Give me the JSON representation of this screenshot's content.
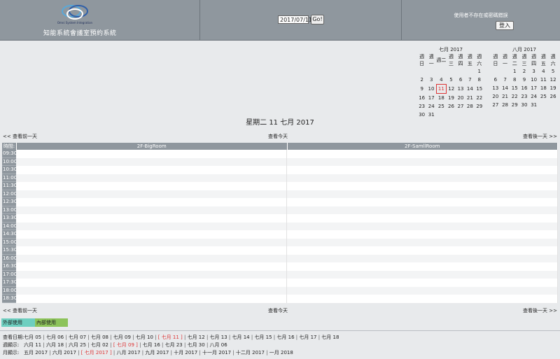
{
  "header": {
    "logo_text": "Omni System Integration",
    "app_title": "知能系統會議室預約系統",
    "date_value": "2017/07/11",
    "go_label": "Go!",
    "user_message": "使用者不存在或密碼錯誤",
    "login_label": "登入"
  },
  "calendars": [
    {
      "title": "七月 2017",
      "weekdays": [
        "週日",
        "週一",
        "週二",
        "週三",
        "週四",
        "週五",
        "週六"
      ],
      "weeks": [
        [
          "",
          "",
          "",
          "",
          "",
          "",
          "1"
        ],
        [
          "2",
          "3",
          "4",
          "5",
          "6",
          "7",
          "8"
        ],
        [
          "9",
          "10",
          "11",
          "12",
          "13",
          "14",
          "15"
        ],
        [
          "16",
          "17",
          "18",
          "19",
          "20",
          "21",
          "22"
        ],
        [
          "23",
          "24",
          "25",
          "26",
          "27",
          "28",
          "29"
        ],
        [
          "30",
          "31",
          "",
          "",
          "",
          "",
          ""
        ]
      ],
      "today": "11"
    },
    {
      "title": "八月 2017",
      "weekdays": [
        "週日",
        "週一",
        "週二",
        "週三",
        "週四",
        "週五",
        "週六"
      ],
      "weeks": [
        [
          "",
          "",
          "1",
          "2",
          "3",
          "4",
          "5"
        ],
        [
          "6",
          "7",
          "8",
          "9",
          "10",
          "11",
          "12"
        ],
        [
          "13",
          "14",
          "15",
          "16",
          "17",
          "18",
          "19"
        ],
        [
          "20",
          "21",
          "22",
          "23",
          "24",
          "25",
          "26"
        ],
        [
          "27",
          "28",
          "29",
          "30",
          "31",
          "",
          ""
        ]
      ],
      "today": ""
    }
  ],
  "day_title": "星期二 11 七月 2017",
  "nav": {
    "prev": "<< 查看前一天",
    "today": "查看今天",
    "next": "查看後一天 >>"
  },
  "grid": {
    "time_header": "時間:",
    "rooms": [
      "2F-BigRoom",
      "2F-SamllRoom"
    ],
    "times": [
      "09:30",
      "10:00",
      "10:30",
      "11:00",
      "11:30",
      "12:00",
      "12:30",
      "13:00",
      "13:30",
      "14:00",
      "14:30",
      "15:00",
      "15:30",
      "16:00",
      "16:30",
      "17:00",
      "17:30",
      "18:00",
      "18:30"
    ]
  },
  "legend": {
    "external": "外部使用",
    "internal": "內部使用",
    "external_color": "#6ecfc0",
    "internal_color": "#8cc35a"
  },
  "footer": {
    "view_date": {
      "label": "查看日期:",
      "items": [
        "七月 05",
        "七月 06",
        "七月 07",
        "七月 08",
        "七月 09",
        "七月 10",
        "[ 七月 11 ]",
        "七月 12",
        "七月 13",
        "七月 14",
        "七月 15",
        "七月 16",
        "七月 17",
        "七月 18"
      ],
      "selected": 6
    },
    "week_view": {
      "label": "週顯示:",
      "items": [
        "六月 11",
        "六月 18",
        "六月 25",
        "七月 02",
        "[ 七月 09 ]",
        "七月 16",
        "七月 23",
        "七月 30",
        "八月 06"
      ],
      "selected": 4
    },
    "month_view": {
      "label": "月顯示:",
      "items": [
        "五月 2017",
        "六月 2017",
        "[ 七月 2017 ]",
        "八月 2017",
        "九月 2017",
        "十月 2017",
        "十一月 2017",
        "十二月 2017",
        "一月 2018"
      ],
      "selected": 2
    }
  },
  "colors": {
    "header_bg": "#8f979e",
    "page_bg": "#e8eaec",
    "highlight": "#dd3333"
  }
}
